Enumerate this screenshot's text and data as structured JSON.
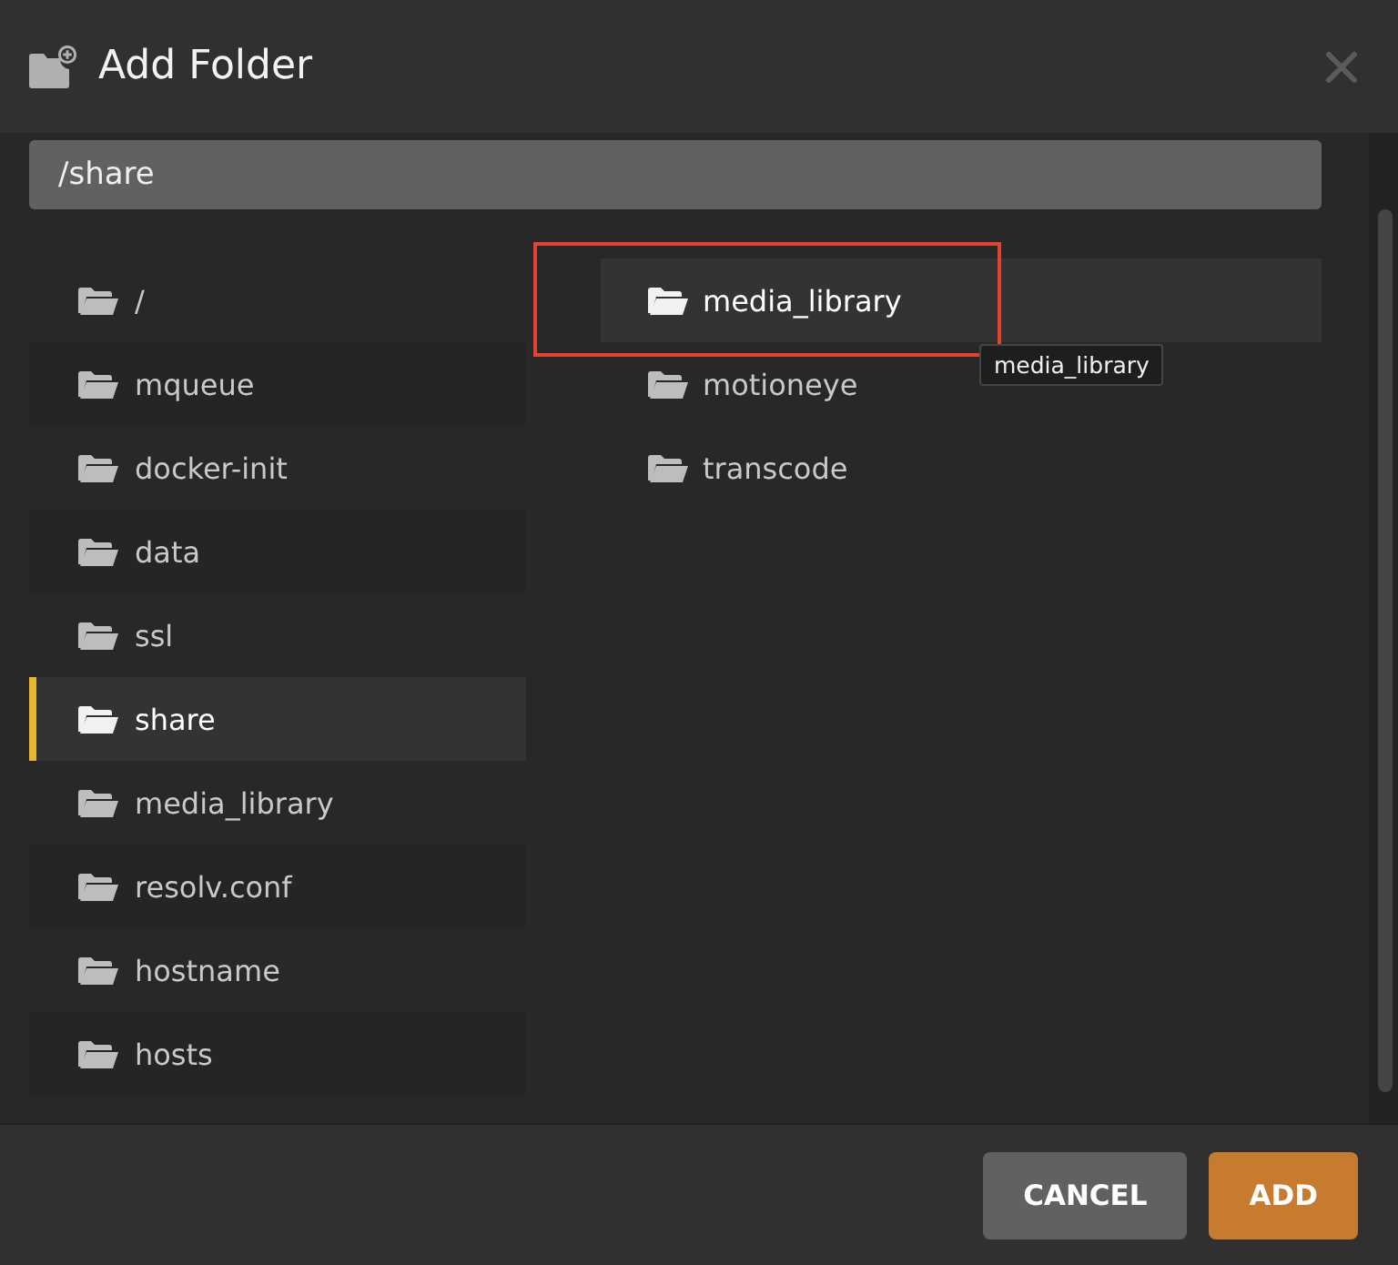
{
  "dialog": {
    "title": "Add Folder"
  },
  "path_field": {
    "value": "/share"
  },
  "folders": [
    {
      "name": "/",
      "selected": false
    },
    {
      "name": "mqueue",
      "selected": false
    },
    {
      "name": "docker-init",
      "selected": false
    },
    {
      "name": "data",
      "selected": false
    },
    {
      "name": "ssl",
      "selected": false
    },
    {
      "name": "share",
      "selected": true
    },
    {
      "name": "media_library",
      "selected": false
    },
    {
      "name": "resolv.conf",
      "selected": false
    },
    {
      "name": "hostname",
      "selected": false
    },
    {
      "name": "hosts",
      "selected": false
    }
  ],
  "subfolders": [
    {
      "name": "media_library",
      "hovered": true,
      "highlighted": true,
      "tooltip": "media_library"
    },
    {
      "name": "motioneye",
      "hovered": false,
      "highlighted": false
    },
    {
      "name": "transcode",
      "hovered": false,
      "highlighted": false
    }
  ],
  "buttons": [
    {
      "label": "CANCEL",
      "kind": "secondary"
    },
    {
      "label": "ADD",
      "kind": "primary"
    }
  ]
}
